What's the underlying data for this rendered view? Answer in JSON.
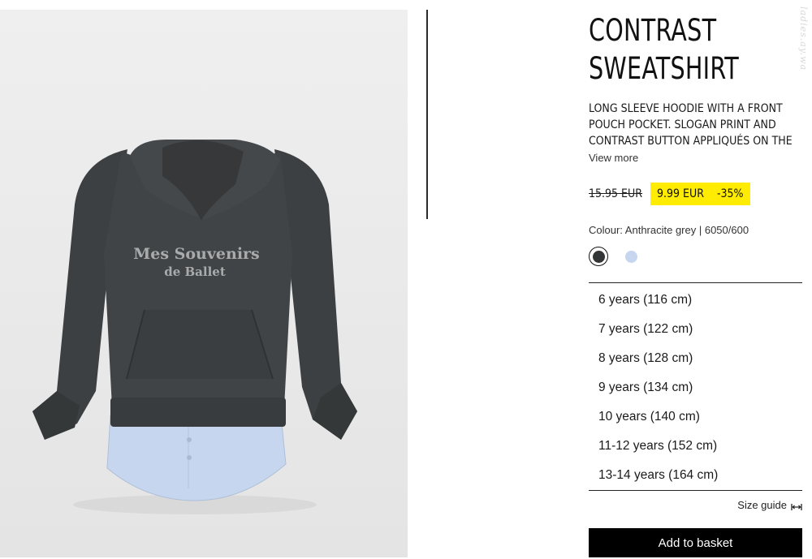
{
  "product": {
    "title_line1": "CONTRAST",
    "title_line2": "SWEATSHIRT",
    "description": "LONG SLEEVE HOODIE WITH A FRONT POUCH POCKET. SLOGAN PRINT AND CONTRAST BUTTON APPLIQUÉS ON THE",
    "view_more": "View more",
    "old_price": "15.95 EUR",
    "sale_price": "9.99 EUR",
    "discount": "-35%",
    "colour_label": "Colour: Anthracite grey | 6050/600",
    "colors": {
      "accent_yellow": "#ffec00",
      "anthracite": "#333536",
      "light_blue": "#c6d6ee"
    }
  },
  "image": {
    "print_line1": "Mes Souvenirs",
    "print_line2": "de Ballet"
  },
  "watermark": "ladies.ay.wa",
  "sizes": [
    "6 years (116 cm)",
    "7 years (122 cm)",
    "8 years (128 cm)",
    "9 years (134 cm)",
    "10 years (140 cm)",
    "11-12 years (152 cm)",
    "13-14 years (164 cm)"
  ],
  "actions": {
    "size_guide": "Size guide",
    "add_to_basket": "Add to basket"
  },
  "icons": {
    "size_guide": "ruler-icon"
  }
}
